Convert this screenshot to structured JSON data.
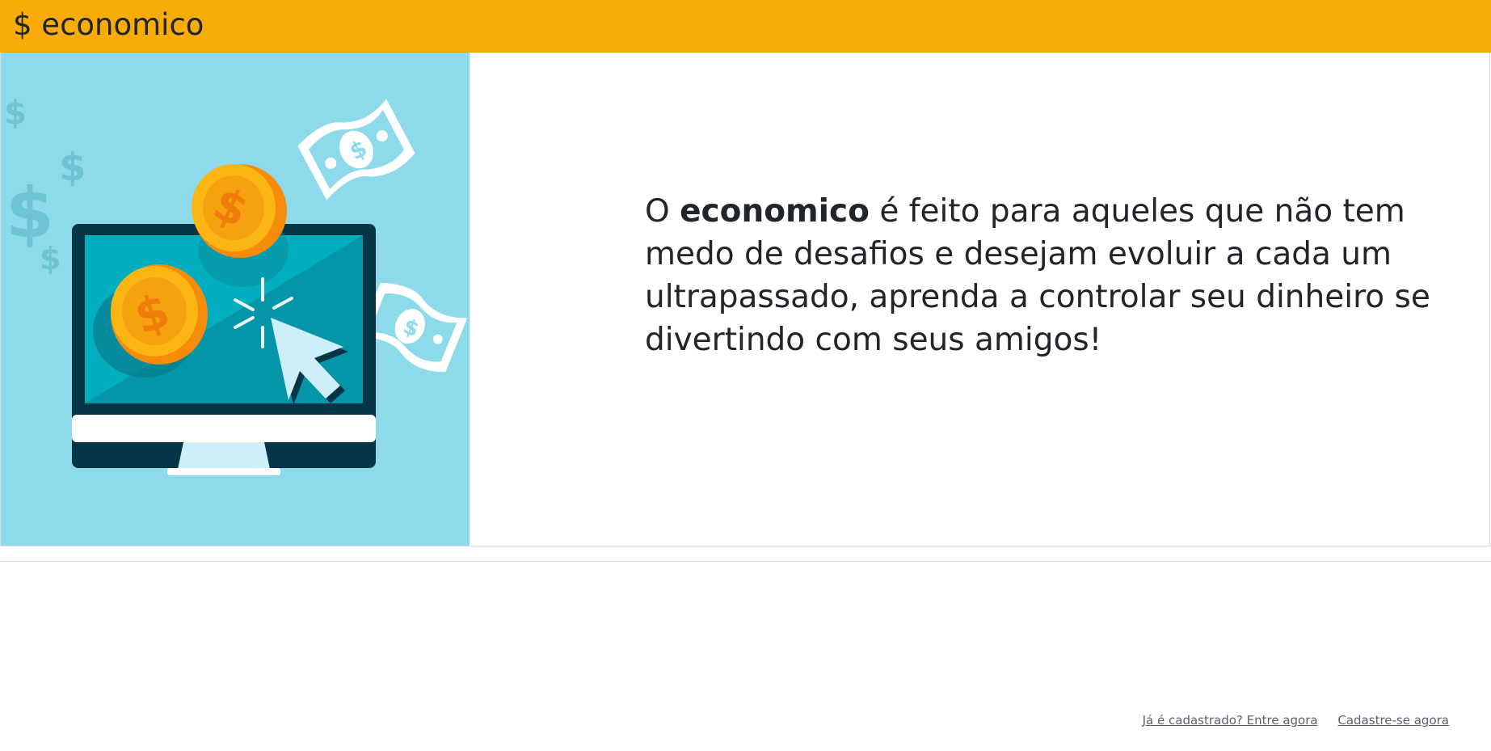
{
  "header": {
    "brand": "$ economico",
    "background_color": "#f9ac08"
  },
  "hero": {
    "illustration": "computer-money-illustration",
    "text_before": "O",
    "text_bold": "economico",
    "text_after": "é feito para aqueles que não tem medo de desafios e desejam evoluir a cada um ultrapassado, aprenda a controlar seu dinheiro se divertindo com seus amigos!"
  },
  "footer": {
    "login_link": "Já é cadastrado? Entre agora",
    "signup_link": "Cadastre-se agora"
  }
}
